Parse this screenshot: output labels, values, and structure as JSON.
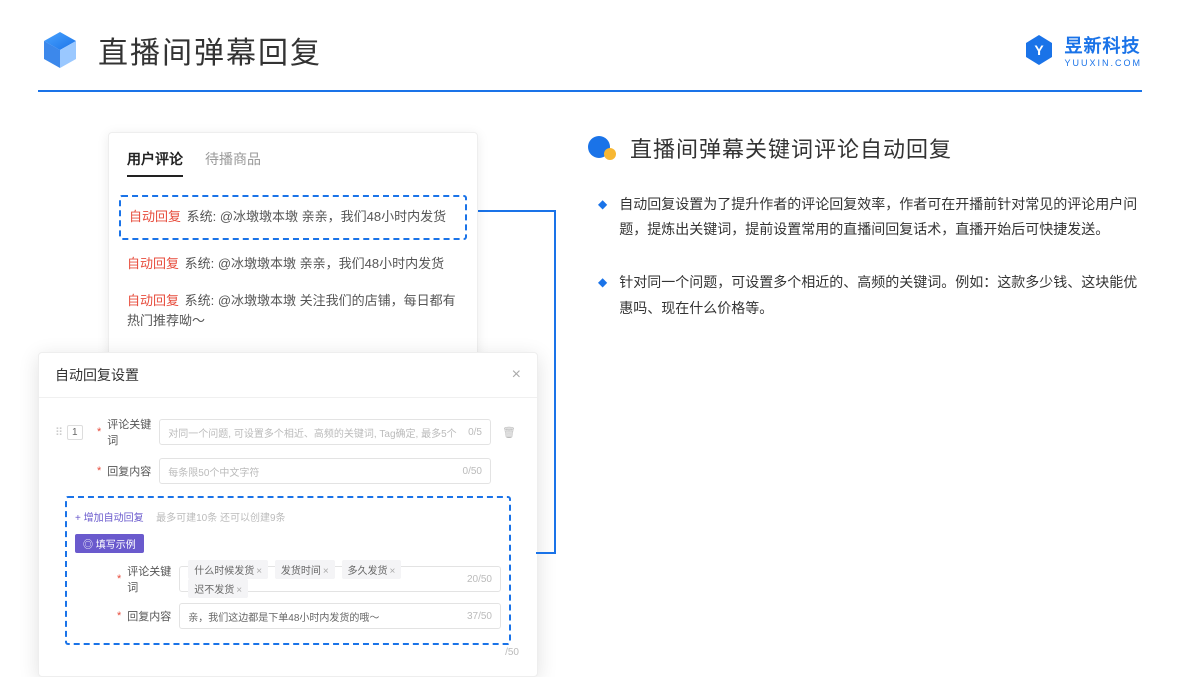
{
  "header": {
    "title": "直播间弹幕回复",
    "brand_cn": "昱新科技",
    "brand_en": "YUUXIN.COM"
  },
  "comments": {
    "tab_active": "用户评论",
    "tab_inactive": "待播商品",
    "items": [
      {
        "tag": "自动回复",
        "body": "系统: @冰墩墩本墩 亲亲，我们48小时内发货"
      },
      {
        "tag": "自动回复",
        "body": "系统: @冰墩墩本墩 亲亲，我们48小时内发货"
      },
      {
        "tag": "自动回复",
        "body": "系统: @冰墩墩本墩 关注我们的店铺，每日都有热门推荐呦～"
      }
    ]
  },
  "settings": {
    "title": "自动回复设置",
    "index": "1",
    "kw_label": "评论关键词",
    "kw_placeholder": "对同一个问题, 可设置多个相近、高频的关键词, Tag确定, 最多5个",
    "kw_count": "0/5",
    "content_label": "回复内容",
    "content_placeholder": "每条限50个中文字符",
    "content_count": "0/50",
    "add_link": "+ 增加自动回复",
    "add_hint": "最多可建10条 还可以创建9条",
    "example_badge": "◎ 填写示例",
    "ex_kw_label": "评论关键词",
    "ex_tags": [
      "什么时候发货",
      "发货时间",
      "多久发货",
      "迟不发货"
    ],
    "ex_kw_count": "20/50",
    "ex_content_label": "回复内容",
    "ex_content_value": "亲，我们这边都是下单48小时内发货的哦～",
    "ex_content_count": "37/50",
    "tail_count": "/50"
  },
  "section": {
    "title": "直播间弹幕关键词评论自动回复",
    "bullets": [
      "自动回复设置为了提升作者的评论回复效率，作者可在开播前针对常见的评论用户问题，提炼出关键词，提前设置常用的直播间回复话术，直播开始后可快捷发送。",
      "针对同一个问题，可设置多个相近的、高频的关键词。例如：这款多少钱、这块能优惠吗、现在什么价格等。"
    ]
  }
}
